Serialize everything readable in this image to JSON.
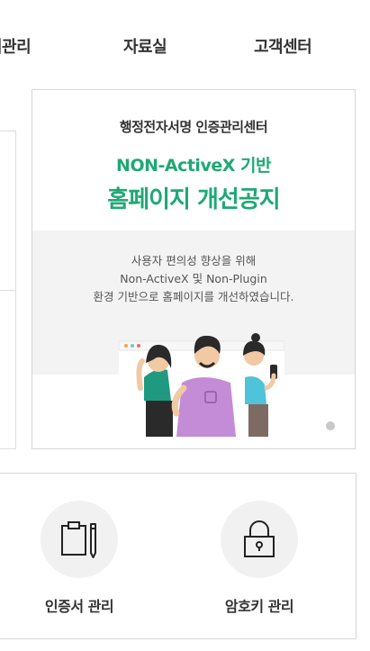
{
  "nav": {
    "items": [
      {
        "label": "서관리"
      },
      {
        "label": "자료실"
      },
      {
        "label": "고객센터"
      }
    ]
  },
  "notice": {
    "subtitle": "행정전자서명 인증관리센터",
    "title_line1": "NON-ActiveX 기반",
    "title_line2": "홈페이지 개선공지",
    "desc_line1": "사용자 편의성 향상을 위해",
    "desc_line2": "Non-ActiveX 및 Non-Plugin",
    "desc_line3": "환경 기반으로 홈페이지를 개선하였습니다."
  },
  "quick_menu": {
    "items": [
      {
        "label": "인증서 관리",
        "icon": "clipboard-pen-icon"
      },
      {
        "label": "암호키 관리",
        "icon": "padlock-icon"
      }
    ]
  },
  "colors": {
    "accent": "#1fa874",
    "gray_bg": "#f3f3f3"
  }
}
